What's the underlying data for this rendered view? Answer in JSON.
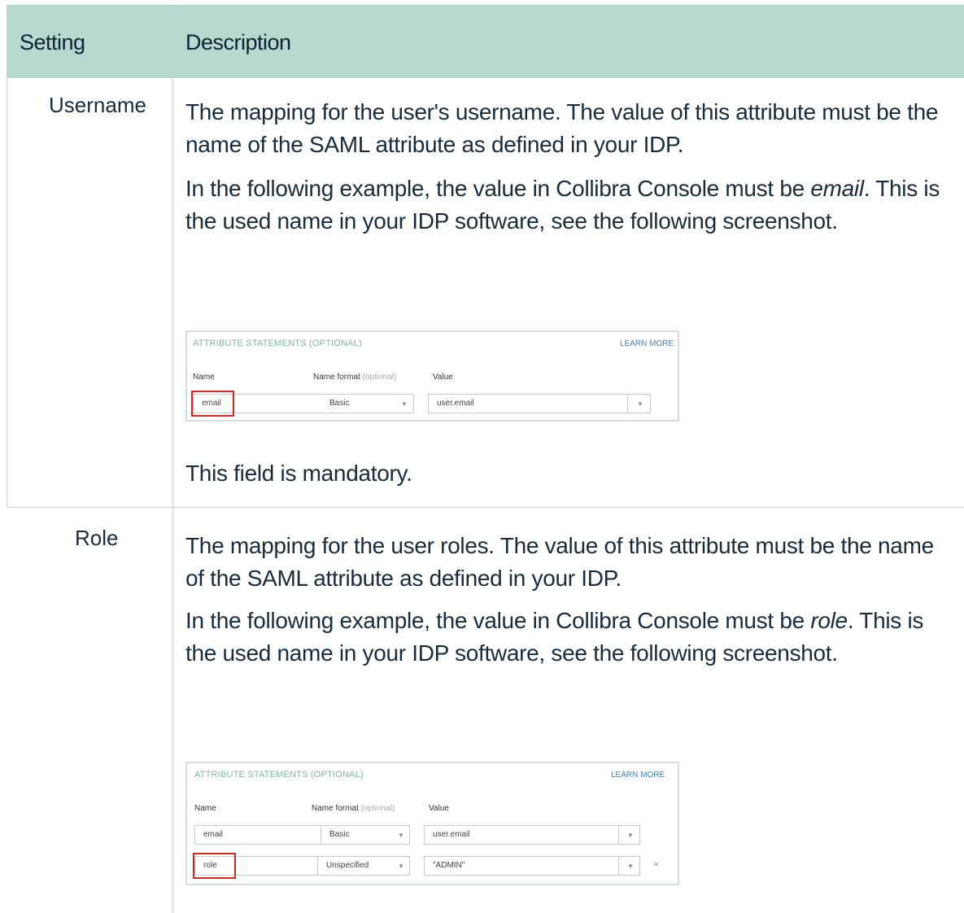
{
  "table": {
    "headers": {
      "setting": "Setting",
      "description": "Description"
    },
    "rows": [
      {
        "setting": "Username",
        "paragraphs": {
          "p1": "The mapping for the user's username. The value of this attribute must be the name of the SAML attribute as defined in your IDP.",
          "p2_prefix": "In the following example, the value in Collibra Console must be ",
          "p2_em": "email",
          "p2_suffix": ". This is the used name in your IDP software, see the following screenshot.",
          "p3": "This field is mandatory."
        },
        "screenshot": {
          "header": "ATTRIBUTE STATEMENTS (OPTIONAL)",
          "learn_more": "LEARN MORE",
          "col_name": "Name",
          "col_format": "Name format",
          "col_format_hint": "(optional)",
          "col_value": "Value",
          "rows": [
            {
              "name": "email",
              "format": "Basic",
              "value": "user.email"
            }
          ]
        }
      },
      {
        "setting": "Role",
        "paragraphs": {
          "p1": "The mapping for the user roles. The value of this attribute must be the name of the SAML attribute as defined in your IDP.",
          "p2_prefix": "In the following example, the value in Collibra Console must be ",
          "p2_em": "role",
          "p2_suffix": ". This is the used name in your IDP software, see the following screenshot."
        },
        "screenshot": {
          "header": "ATTRIBUTE STATEMENTS (OPTIONAL)",
          "learn_more": "LEARN MORE",
          "col_name": "Name",
          "col_format": "Name format",
          "col_format_hint": "(optional)",
          "col_value": "Value",
          "rows": [
            {
              "name": "email",
              "format": "Basic",
              "value": "user.email"
            },
            {
              "name": "role",
              "format": "Unspecified",
              "value": "\"ADMIN\"",
              "remove": "×"
            }
          ]
        }
      }
    ]
  },
  "icons": {
    "dropdown": "▼"
  },
  "colors": {
    "header_bg": "#b5d8cf",
    "highlight": "#dd2222",
    "section_title": "#7fb6a9",
    "link": "#4a7fb5"
  }
}
